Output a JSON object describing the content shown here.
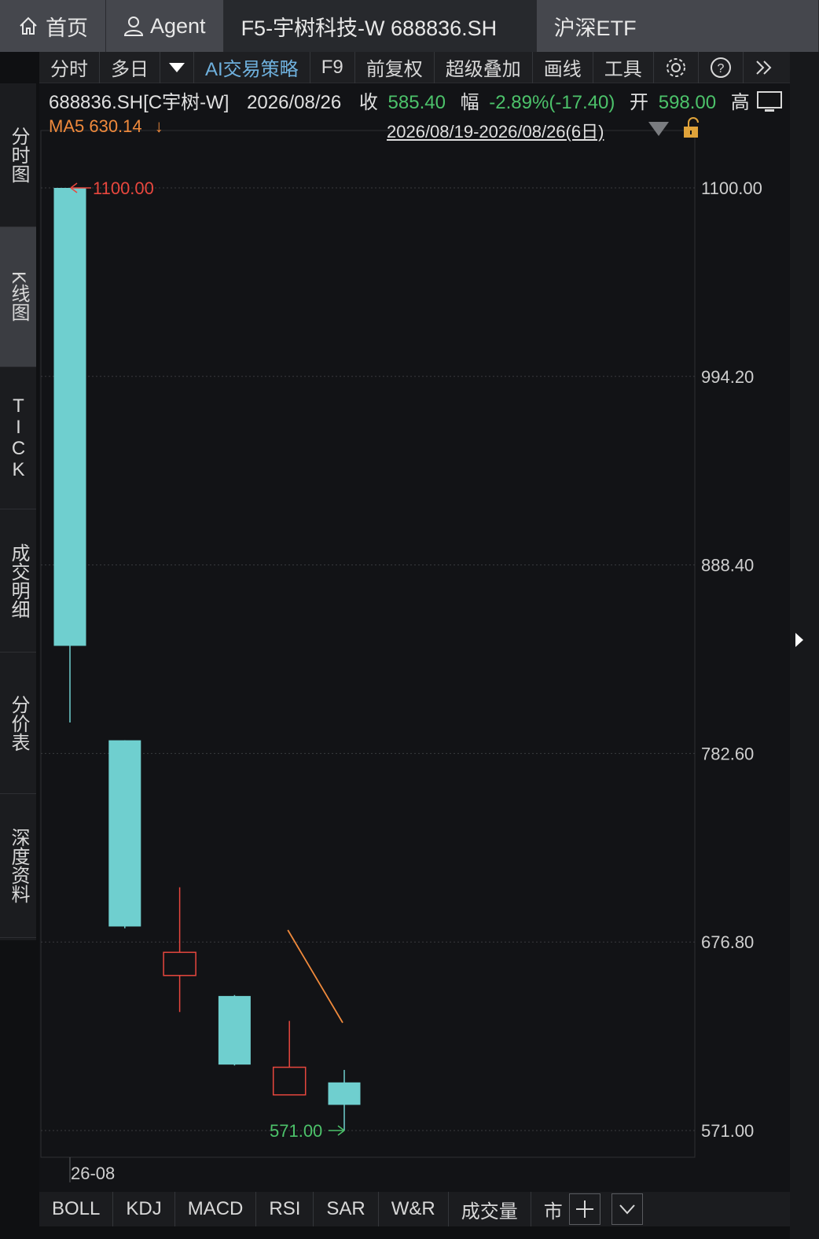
{
  "tabs": [
    {
      "label": "首页",
      "icon": "home-icon"
    },
    {
      "label": "Agent",
      "icon": "user-icon"
    },
    {
      "label": "F5-宇树科技-W 688836.SH",
      "icon": ""
    },
    {
      "label": "沪深ETF",
      "icon": ""
    }
  ],
  "toolbar": {
    "fenshi": "分时",
    "duori": "多日",
    "ai": "AI交易策略",
    "f9": "F9",
    "qianfuquan": "前复权",
    "chaoji": "超级叠加",
    "huaxian": "画线",
    "gongju": "工具"
  },
  "sidebar": [
    "分时图",
    "K线图",
    "TICK",
    "成交明细",
    "分价表",
    "深度资料"
  ],
  "info": {
    "code": "688836.SH[C宇树-W]",
    "date": "2026/08/26",
    "close_label": "收",
    "close": "585.40",
    "chg_label": "幅",
    "chg": "-2.89%(-17.40)",
    "open_label": "开",
    "open": "598.00",
    "high_label": "高"
  },
  "ma": {
    "label": "MA5 630.14",
    "arrow": "↓"
  },
  "range": "2026/08/19-2026/08/26(6日)",
  "chart_data": {
    "type": "candlestick",
    "ylim": [
      571.0,
      1100.0
    ],
    "ticks": [
      "1100.00",
      "994.20",
      "888.40",
      "782.60",
      "676.80",
      "571.00"
    ],
    "tick_values": [
      1100.0,
      994.2,
      888.4,
      782.6,
      676.8,
      571.0
    ],
    "xlabel_first": "26-08",
    "max_label": "1100.00",
    "min_label": "571.00",
    "candles": [
      {
        "open": 1100.0,
        "close": 843.0,
        "high": 1100.0,
        "low": 800.0,
        "dir": "down"
      },
      {
        "open": 790.0,
        "close": 685.5,
        "high": 790.0,
        "low": 684.5,
        "dir": "down"
      },
      {
        "open": 658.0,
        "close": 671.0,
        "high": 707.5,
        "low": 637.5,
        "dir": "up"
      },
      {
        "open": 646.5,
        "close": 608.0,
        "high": 647.0,
        "low": 607.5,
        "dir": "down"
      },
      {
        "open": 591.0,
        "close": 606.5,
        "high": 632.5,
        "low": 591.0,
        "dir": "up"
      },
      {
        "open": 598.0,
        "close": 585.4,
        "high": 605.0,
        "low": 571.0,
        "dir": "down"
      }
    ],
    "ma5_line": [
      {
        "i": 4,
        "v": 683.5
      },
      {
        "i": 5,
        "v": 631.5
      }
    ],
    "colors": {
      "down": "#6fcfcf",
      "up": "#e8473e",
      "ma5": "#f08a3c",
      "grid": "#3a3b3f"
    }
  },
  "bottom": [
    "BOLL",
    "KDJ",
    "MACD",
    "RSI",
    "SAR",
    "W&R",
    "成交量",
    "市"
  ]
}
